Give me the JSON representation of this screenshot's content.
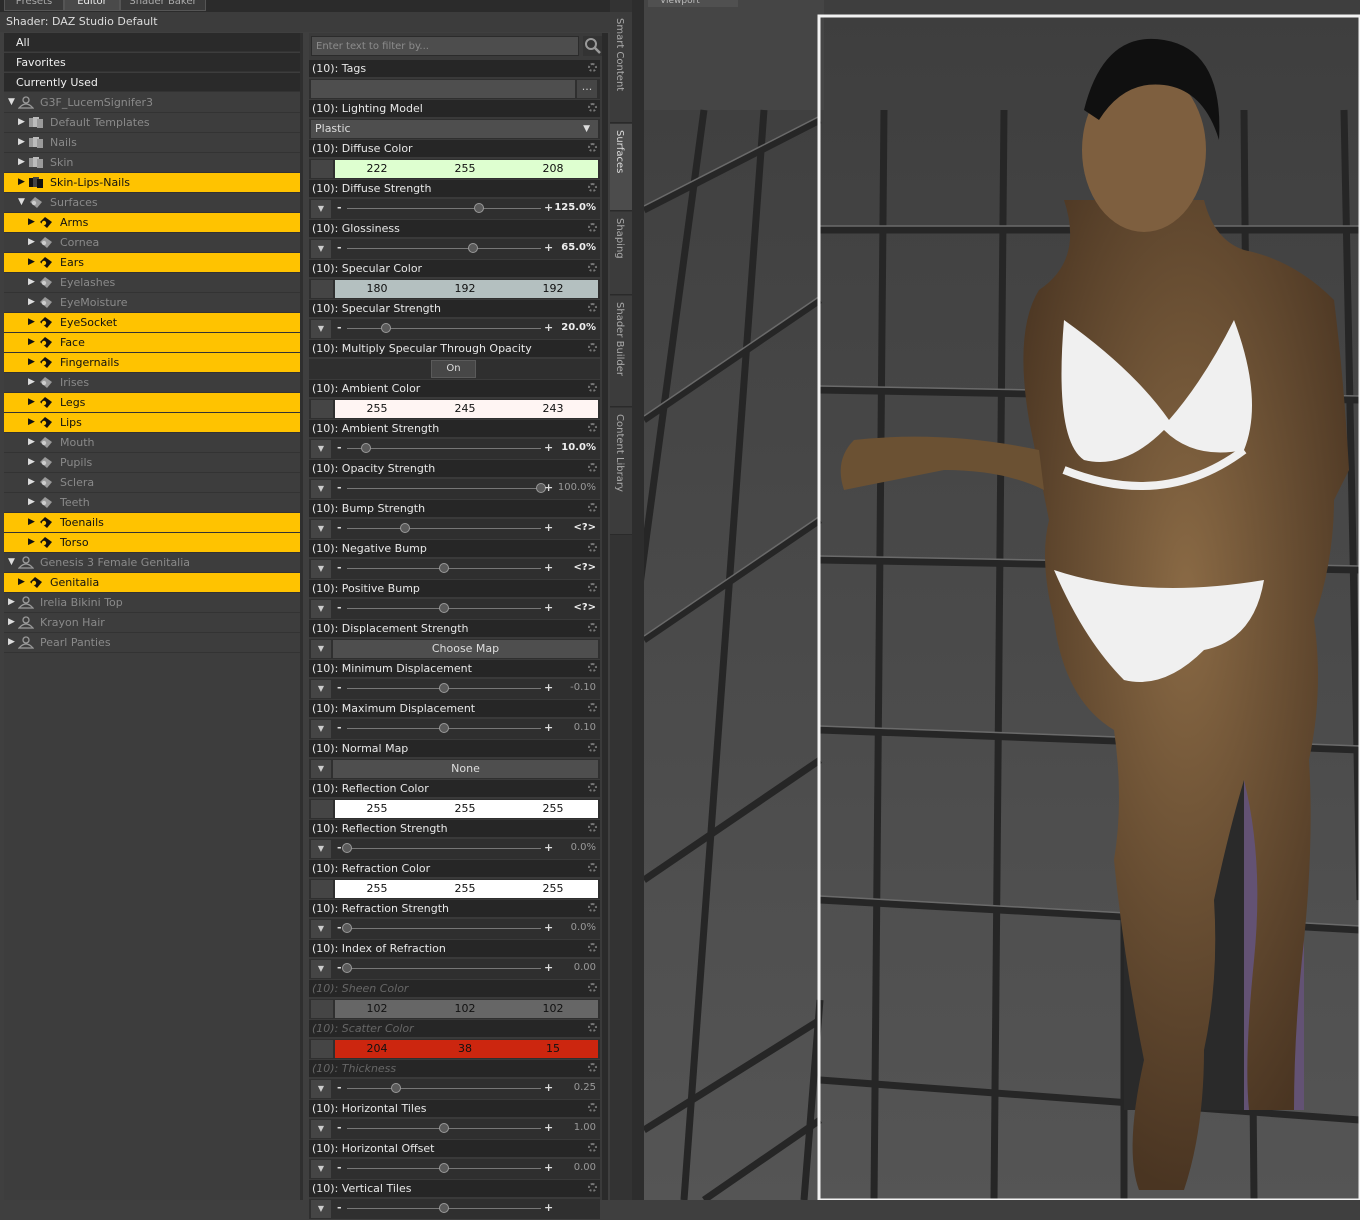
{
  "tabs": [
    "Presets",
    "Editor",
    "Shader Baker"
  ],
  "shader_line": "Shader: DAZ Studio Default",
  "categories": [
    "All",
    "Favorites",
    "Currently Used"
  ],
  "tree": [
    {
      "label": "G3F_LucemSignifer3",
      "level": 0,
      "arrow": "down",
      "hl": false,
      "icon": "figure"
    },
    {
      "label": "Default Templates",
      "level": 1,
      "arrow": "right",
      "hl": false,
      "icon": "template"
    },
    {
      "label": "Nails",
      "level": 1,
      "arrow": "right",
      "hl": false,
      "icon": "template"
    },
    {
      "label": "Skin",
      "level": 1,
      "arrow": "right",
      "hl": false,
      "icon": "template"
    },
    {
      "label": "Skin-Lips-Nails",
      "level": 1,
      "arrow": "right",
      "hl": true,
      "icon": "template"
    },
    {
      "label": "Surfaces",
      "level": 1,
      "arrow": "down",
      "hl": false,
      "icon": "surface"
    },
    {
      "label": "Arms",
      "level": 2,
      "arrow": "right",
      "hl": true,
      "icon": "surface"
    },
    {
      "label": "Cornea",
      "level": 2,
      "arrow": "right",
      "hl": false,
      "icon": "surface"
    },
    {
      "label": "Ears",
      "level": 2,
      "arrow": "right",
      "hl": true,
      "icon": "surface"
    },
    {
      "label": "Eyelashes",
      "level": 2,
      "arrow": "right",
      "hl": false,
      "icon": "surface"
    },
    {
      "label": "EyeMoisture",
      "level": 2,
      "arrow": "right",
      "hl": false,
      "icon": "surface"
    },
    {
      "label": "EyeSocket",
      "level": 2,
      "arrow": "right",
      "hl": true,
      "icon": "surface"
    },
    {
      "label": "Face",
      "level": 2,
      "arrow": "right",
      "hl": true,
      "icon": "surface"
    },
    {
      "label": "Fingernails",
      "level": 2,
      "arrow": "right",
      "hl": true,
      "icon": "surface"
    },
    {
      "label": "Irises",
      "level": 2,
      "arrow": "right",
      "hl": false,
      "icon": "surface"
    },
    {
      "label": "Legs",
      "level": 2,
      "arrow": "right",
      "hl": true,
      "icon": "surface"
    },
    {
      "label": "Lips",
      "level": 2,
      "arrow": "right",
      "hl": true,
      "icon": "surface"
    },
    {
      "label": "Mouth",
      "level": 2,
      "arrow": "right",
      "hl": false,
      "icon": "surface"
    },
    {
      "label": "Pupils",
      "level": 2,
      "arrow": "right",
      "hl": false,
      "icon": "surface"
    },
    {
      "label": "Sclera",
      "level": 2,
      "arrow": "right",
      "hl": false,
      "icon": "surface"
    },
    {
      "label": "Teeth",
      "level": 2,
      "arrow": "right",
      "hl": false,
      "icon": "surface"
    },
    {
      "label": "Toenails",
      "level": 2,
      "arrow": "right",
      "hl": true,
      "icon": "surface"
    },
    {
      "label": "Torso",
      "level": 2,
      "arrow": "right",
      "hl": true,
      "icon": "surface"
    },
    {
      "label": "Genesis 3 Female Genitalia",
      "level": 0,
      "arrow": "down",
      "hl": false,
      "icon": "figure"
    },
    {
      "label": "Genitalia",
      "level": 1,
      "arrow": "right",
      "hl": true,
      "icon": "surface"
    },
    {
      "label": "Irelia Bikini Top",
      "level": 0,
      "arrow": "right",
      "hl": false,
      "icon": "figure"
    },
    {
      "label": "Krayon Hair",
      "level": 0,
      "arrow": "right",
      "hl": false,
      "icon": "figure"
    },
    {
      "label": "Pearl Panties",
      "level": 0,
      "arrow": "right",
      "hl": false,
      "icon": "figure"
    }
  ],
  "filter_placeholder": "Enter text to filter by...",
  "properties": [
    {
      "label": "(10): Tags",
      "type": "tags",
      "button": "..."
    },
    {
      "label": "(10): Lighting Model",
      "type": "dropdown",
      "value": "Plastic"
    },
    {
      "label": "(10): Diffuse Color",
      "type": "color",
      "rgb": [
        222,
        255,
        208
      ],
      "bg": "#deffd0"
    },
    {
      "label": "(10): Diffuse Strength",
      "type": "slider",
      "pos": 0.68,
      "value": "125.0%",
      "bold": true
    },
    {
      "label": "(10): Glossiness",
      "type": "slider",
      "pos": 0.65,
      "value": "65.0%",
      "bold": true
    },
    {
      "label": "(10): Specular Color",
      "type": "color",
      "rgb": [
        180,
        192,
        192
      ],
      "bg": "#b4c0c0"
    },
    {
      "label": "(10): Specular Strength",
      "type": "slider",
      "pos": 0.2,
      "value": "20.0%",
      "bold": true
    },
    {
      "label": "(10): Multiply Specular Through Opacity",
      "type": "toggle",
      "value": "On"
    },
    {
      "label": "(10): Ambient Color",
      "type": "color",
      "rgb": [
        255,
        245,
        243
      ],
      "bg": "#fff5f3"
    },
    {
      "label": "(10): Ambient Strength",
      "type": "slider",
      "pos": 0.1,
      "value": "10.0%",
      "bold": true
    },
    {
      "label": "(10): Opacity Strength",
      "type": "slider",
      "pos": 1.0,
      "value": "100.0%",
      "bold": false
    },
    {
      "label": "(10): Bump Strength",
      "type": "slider",
      "pos": 0.3,
      "value": "<?>",
      "bold": true
    },
    {
      "label": "(10): Negative Bump",
      "type": "slider",
      "pos": 0.5,
      "value": "<?>",
      "bold": true
    },
    {
      "label": "(10): Positive Bump",
      "type": "slider",
      "pos": 0.5,
      "value": "<?>",
      "bold": true
    },
    {
      "label": "(10): Displacement Strength",
      "type": "map",
      "value": "Choose Map"
    },
    {
      "label": "(10): Minimum Displacement",
      "type": "slider",
      "pos": 0.5,
      "value": "-0.10",
      "bold": false
    },
    {
      "label": "(10): Maximum Displacement",
      "type": "slider",
      "pos": 0.5,
      "value": "0.10",
      "bold": false
    },
    {
      "label": "(10): Normal Map",
      "type": "map",
      "value": "None"
    },
    {
      "label": "(10): Reflection Color",
      "type": "color",
      "rgb": [
        255,
        255,
        255
      ],
      "bg": "#ffffff"
    },
    {
      "label": "(10): Reflection Strength",
      "type": "slider",
      "pos": 0.0,
      "value": "0.0%",
      "bold": false
    },
    {
      "label": "(10): Refraction Color",
      "type": "color",
      "rgb": [
        255,
        255,
        255
      ],
      "bg": "#ffffff"
    },
    {
      "label": "(10): Refraction Strength",
      "type": "slider",
      "pos": 0.0,
      "value": "0.0%",
      "bold": false
    },
    {
      "label": "(10): Index of Refraction",
      "type": "slider",
      "pos": 0.0,
      "value": "0.00",
      "bold": false
    },
    {
      "label": "(10): Sheen Color",
      "type": "color",
      "rgb": [
        102,
        102,
        102
      ],
      "bg": "#666666",
      "ghost": true
    },
    {
      "label": "(10): Scatter Color",
      "type": "color",
      "rgb": [
        204,
        38,
        15
      ],
      "bg": "#cc260f",
      "ghost": true
    },
    {
      "label": "(10): Thickness",
      "type": "slider",
      "pos": 0.25,
      "value": "0.25",
      "bold": false,
      "ghost": true
    },
    {
      "label": "(10): Horizontal Tiles",
      "type": "slider",
      "pos": 0.5,
      "value": "1.00",
      "bold": false
    },
    {
      "label": "(10): Horizontal Offset",
      "type": "slider",
      "pos": 0.5,
      "value": "0.00",
      "bold": false
    },
    {
      "label": "(10): Vertical Tiles",
      "type": "slider",
      "pos": 0.5,
      "value": "",
      "bold": false
    }
  ],
  "side_tabs": [
    "Smart Content",
    "Surfaces",
    "Shaping",
    "Shader Builder",
    "Content Library"
  ],
  "viewport_tab": "Viewport"
}
